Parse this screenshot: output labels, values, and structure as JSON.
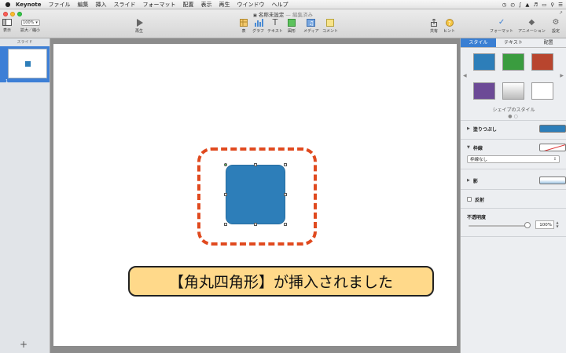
{
  "menubar": {
    "app_name": "Keynote",
    "items": [
      "ファイル",
      "編集",
      "挿入",
      "スライド",
      "フォーマット",
      "配置",
      "表示",
      "再生",
      "ウインドウ",
      "ヘルプ"
    ],
    "clock": " "
  },
  "window": {
    "title": "名称未設定",
    "subtitle": "— 編集済み"
  },
  "toolbar": {
    "view_label": "表示",
    "zoom_value": "100%",
    "zoom_label": "拡大／縮小",
    "play_label": "再生",
    "table_label": "表",
    "chart_label": "グラフ",
    "text_label": "テキスト",
    "shape_label": "図形",
    "media_label": "メディア",
    "comment_label": "コメント",
    "share_label": "共有",
    "tips_label": "ヒント",
    "format_label": "フォーマット",
    "animate_label": "アニメーション",
    "document_label": "設定"
  },
  "slides_pane": {
    "header": "スライド",
    "slide_number": "1",
    "add_label": "+"
  },
  "slide": {
    "caption": "【角丸四角形】が挿入されました"
  },
  "inspector": {
    "tabs": [
      "スタイル",
      "テキスト",
      "配置"
    ],
    "swatch_caption": "シェイプのスタイル",
    "fill_label": "塗りつぶし",
    "border_label": "枠線",
    "border_value": "枠線なし",
    "shadow_label": "影",
    "reflection_label": "反射",
    "opacity_label": "不透明度",
    "opacity_value": "100%"
  },
  "colors": {
    "shape_fill": "#2d7eb9",
    "callout_border": "#e04a1f",
    "caption_bg": "#ffd98a",
    "accent": "#3a7fd3"
  }
}
